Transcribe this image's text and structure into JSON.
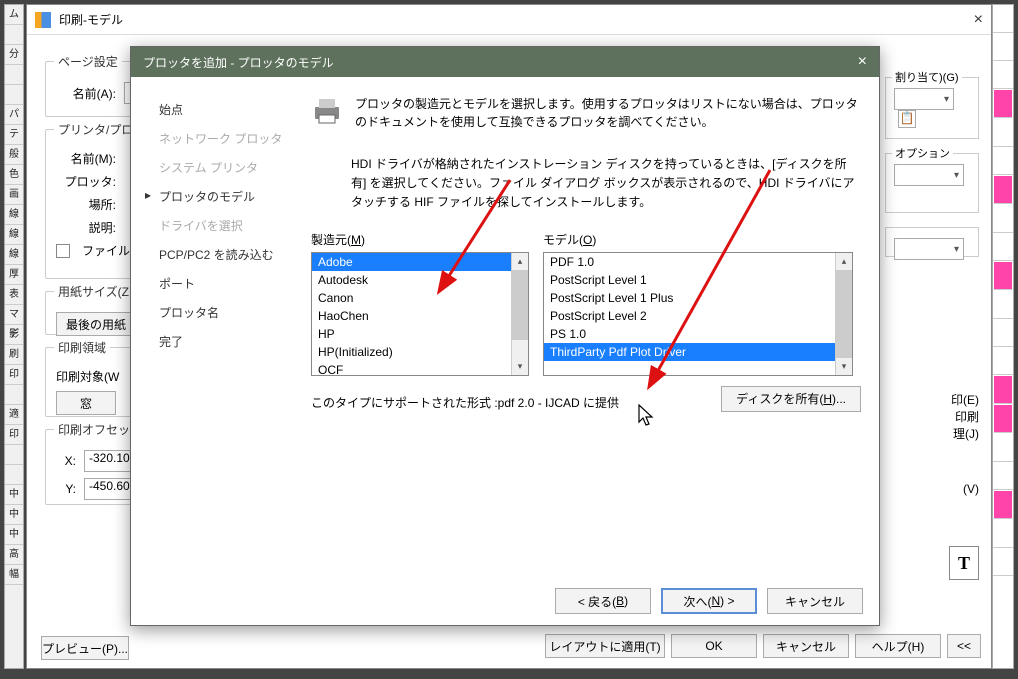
{
  "bg_window": {
    "title": "印刷-モデル",
    "page_settings_legend": "ページ設定",
    "page_name_label": "名前(A):",
    "printer_legend": "プリンタ/プロッ",
    "printer_name_label": "名前(M):",
    "plotter_label": "プロッタ:",
    "location_label": "場所:",
    "description_label": "説明:",
    "print_to_file_label": "ファイル",
    "paper_size_legend": "用紙サイズ(Z",
    "paper_button": "最後の用紙",
    "print_area_legend": "印刷領域",
    "print_target_label": "印刷対象(W",
    "print_target_value": "窓",
    "print_offset_legend": "印刷オフセット",
    "x_label": "X:",
    "x_value": "-320.10",
    "y_label": "Y:",
    "-450_label": "-450.60",
    "preview_button": "プレビュー(P)...",
    "apply_layout_button": "レイアウトに適用(T)",
    "ok_button": "OK",
    "cancel_button": "キャンセル",
    "help_button": "ヘルプ(H)",
    "collapse_button": "<<",
    "assignment_legend_partial": "割り当て)(G)",
    "option_legend_partial": "オプション",
    "print_ie_label": "印(E)",
    "print_label_partial": "印刷",
    "ri_label": "理(J)",
    "v_label": "(V)"
  },
  "wizard": {
    "title": "プロッタを追加 - プロッタのモデル",
    "steps": {
      "start": "始点",
      "network": "ネットワーク プロッタ",
      "system": "システム プリンタ",
      "model": "プロッタのモデル",
      "driver": "ドライバを選択",
      "pcp": "PCP/PC2 を読み込む",
      "port": "ポート",
      "name": "プロッタ名",
      "finish": "完了"
    },
    "top_text1": "プロッタの製造元とモデルを選択します。使用するプロッタはリストにない場合は、プロッタのドキュメントを使用して互換できるプロッタを調べてください。",
    "hint_text": "HDI ドライバが格納されたインストレーション ディスクを持っているときは、[ディスクを所有] を選択してください。ファイル ダイアログ ボックスが表示されるので、HDI ドライバにアタッチする HIF ファイルを探してインストールします。",
    "manufacturer_label": "製造元(M)",
    "model_label": "モデル(O)",
    "manufacturers": [
      "Adobe",
      "Autodesk",
      "Canon",
      "HaoChen",
      "HP",
      "HP(Initialized)",
      "OCF"
    ],
    "models": [
      "PDF 1.0",
      "PostScript Level 1",
      "PostScript Level 1 Plus",
      "PostScript Level 2",
      "PS 1.0",
      "ThirdParty Pdf Plot Driver"
    ],
    "selected_manufacturer_index": 0,
    "selected_model_index": 5,
    "support_text": "このタイプにサポートされた形式 :pdf 2.0 - IJCAD に提供",
    "disk_button": "ディスクを所有(H)...",
    "back_button": "< 戻る(B)",
    "next_button": "次へ(N) >",
    "cancel_button": "キャンセル"
  },
  "left_strip_labels": [
    "ム",
    "",
    "分",
    "",
    "",
    "パテ",
    "",
    "般",
    "色",
    "画",
    "線",
    "線",
    "線",
    "厚",
    "表",
    "マデ",
    "影",
    "刷",
    "印",
    "",
    "適",
    "印",
    "",
    "",
    "中",
    "中",
    "中",
    "高",
    "幅"
  ]
}
